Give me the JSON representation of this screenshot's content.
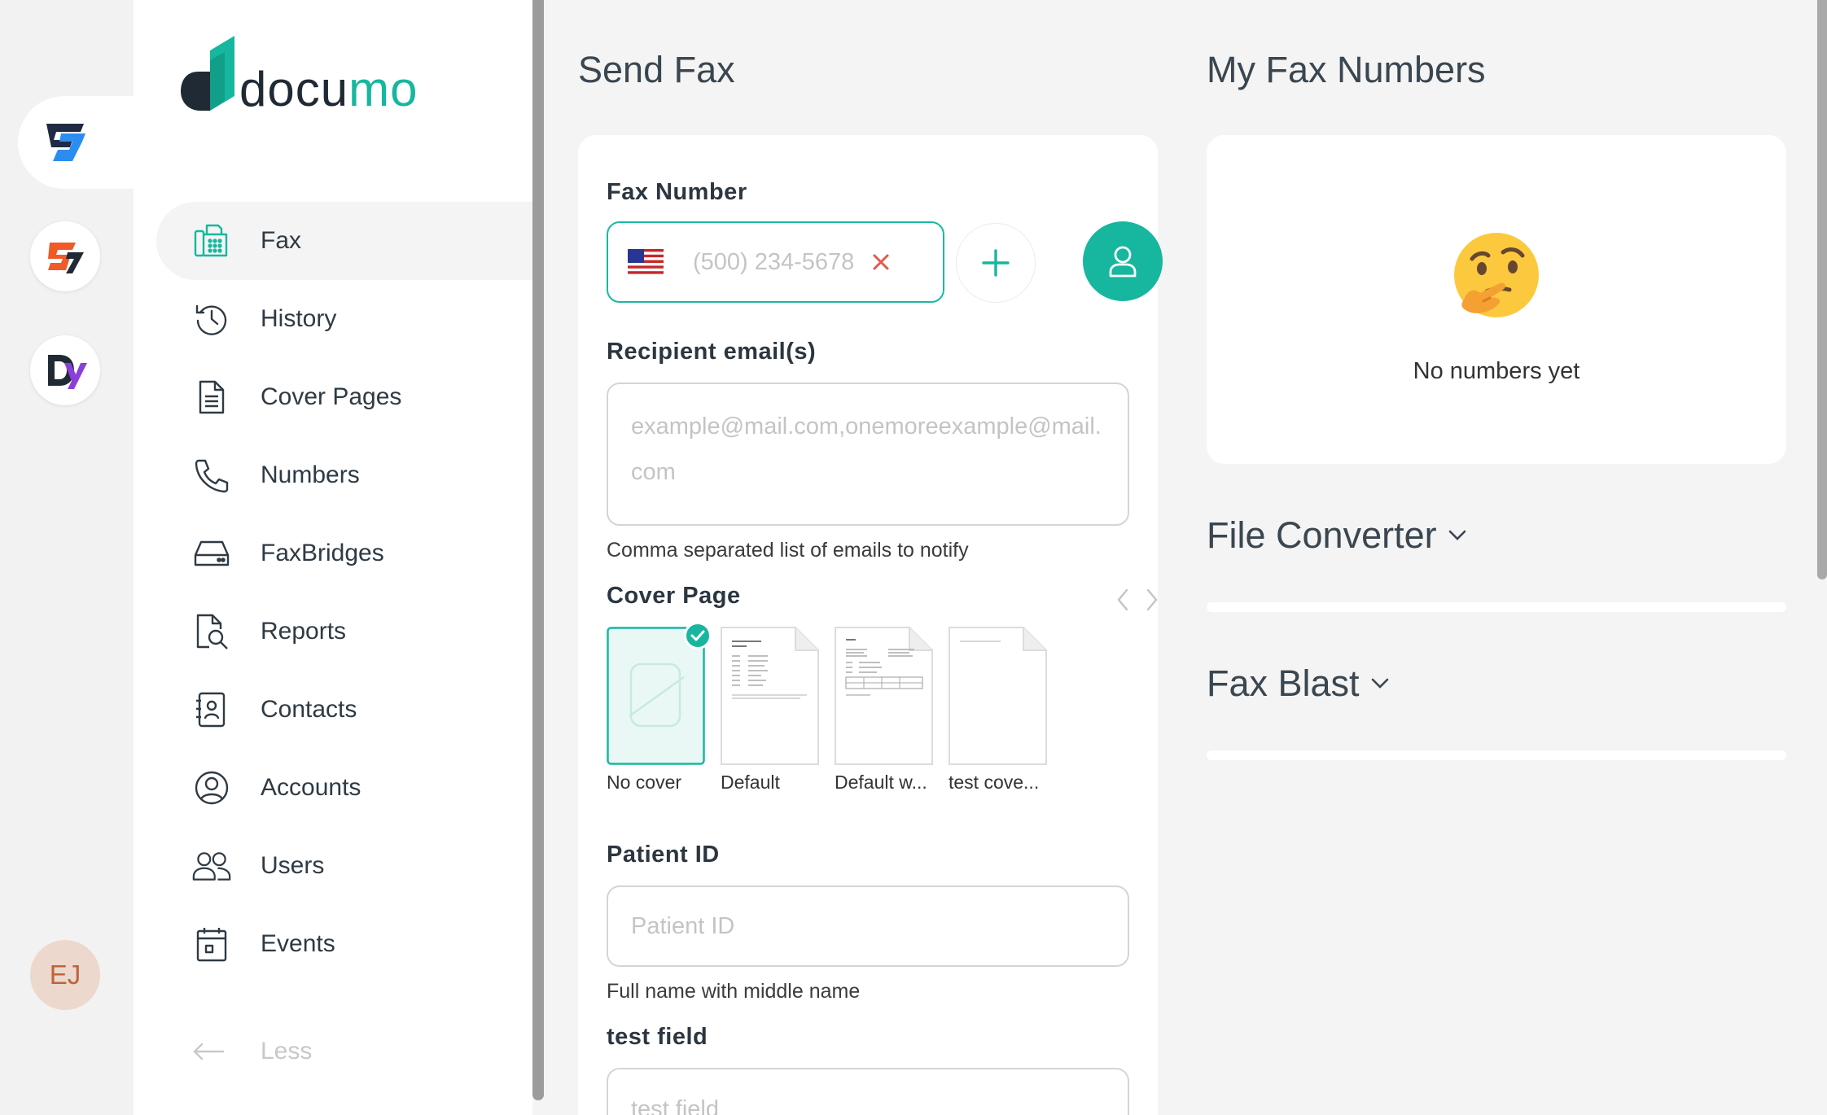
{
  "apps": [
    {
      "name": "fax-app",
      "color": "#1e88e5"
    },
    {
      "name": "sign-app",
      "color": "#ef5a2a"
    },
    {
      "name": "docs-app",
      "color": "#8b3fd9"
    }
  ],
  "user": {
    "initials": "EJ"
  },
  "brand": {
    "name_main": "docu",
    "name_accent": "mo",
    "accent": "#16b79e"
  },
  "nav": {
    "items": [
      {
        "label": "Fax",
        "icon": "fax-icon",
        "active": true
      },
      {
        "label": "History",
        "icon": "history-icon"
      },
      {
        "label": "Cover Pages",
        "icon": "document-icon"
      },
      {
        "label": "Numbers",
        "icon": "phone-icon"
      },
      {
        "label": "FaxBridges",
        "icon": "hard-drive-icon"
      },
      {
        "label": "Reports",
        "icon": "report-search-icon"
      },
      {
        "label": "Contacts",
        "icon": "contact-card-icon"
      },
      {
        "label": "Accounts",
        "icon": "account-circle-icon"
      },
      {
        "label": "Users",
        "icon": "users-icon"
      },
      {
        "label": "Events",
        "icon": "calendar-icon"
      }
    ],
    "less_label": "Less"
  },
  "send_fax": {
    "title": "Send Fax",
    "fax_number_label": "Fax Number",
    "fax_number_placeholder": "(500) 234-5678",
    "recipient_label": "Recipient email(s)",
    "recipient_placeholder": "example@mail.com,onemoreexample@mail.com",
    "recipient_hint": "Comma separated list of emails to notify",
    "cover_page_label": "Cover Page",
    "covers": [
      {
        "label": "No cover",
        "selected": true
      },
      {
        "label": "Default",
        "selected": false
      },
      {
        "label": "Default w...",
        "selected": false
      },
      {
        "label": "test cove...",
        "selected": false
      }
    ],
    "patient_id_label": "Patient ID",
    "patient_id_placeholder": "Patient ID",
    "patient_id_hint": "Full name with middle name",
    "test_field_label": "test field",
    "test_field_placeholder": "test field"
  },
  "my_fax_numbers": {
    "title": "My Fax Numbers",
    "empty_text": "No numbers yet"
  },
  "file_converter": {
    "title": "File Converter"
  },
  "fax_blast": {
    "title": "Fax Blast"
  }
}
